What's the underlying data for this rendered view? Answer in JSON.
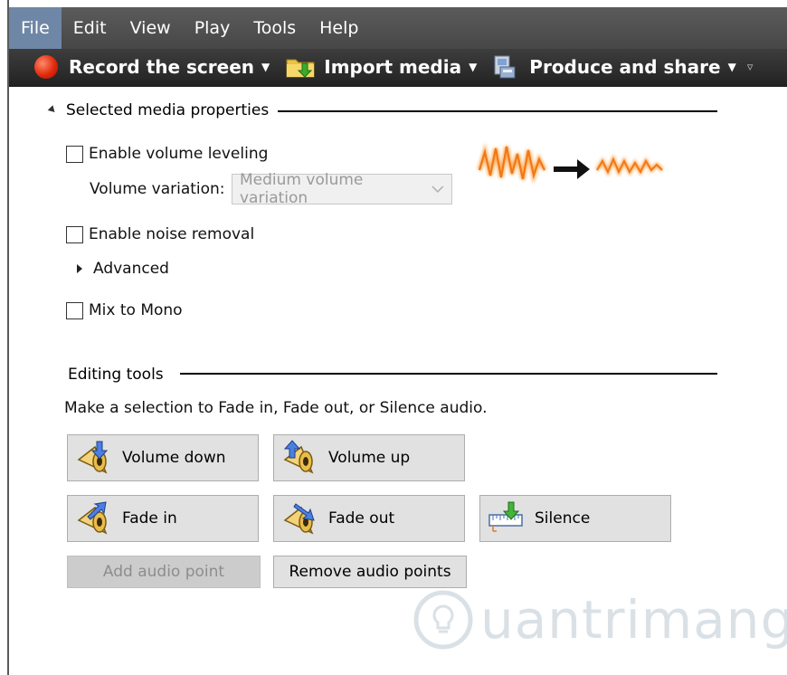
{
  "menu": {
    "items": [
      {
        "label": "File",
        "active": true
      },
      {
        "label": "Edit"
      },
      {
        "label": "View"
      },
      {
        "label": "Play"
      },
      {
        "label": "Tools"
      },
      {
        "label": "Help"
      }
    ]
  },
  "toolbar": {
    "record_label": "Record the screen",
    "import_label": "Import media",
    "produce_label": "Produce and share"
  },
  "media_props": {
    "heading": "Selected media properties",
    "volume_leveling_label": "Enable volume leveling",
    "volume_variation_label": "Volume variation:",
    "volume_variation_value": "Medium volume variation",
    "noise_removal_label": "Enable noise removal",
    "advanced_label": "Advanced",
    "mix_mono_label": "Mix to Mono"
  },
  "editing": {
    "heading": "Editing tools",
    "instruction": "Make a selection to Fade in, Fade out, or Silence audio.",
    "volume_down": "Volume down",
    "volume_up": "Volume up",
    "fade_in": "Fade in",
    "fade_out": "Fade out",
    "silence": "Silence",
    "add_point": "Add audio point",
    "remove_points": "Remove audio points"
  },
  "watermark": {
    "brand": "uantrimang"
  },
  "colors": {
    "menubar": "#4f4f4f",
    "toolbar": "#2e2e2e",
    "active_menu": "#6e87a6",
    "record": "#e02a0c",
    "wave": "#f07818"
  }
}
